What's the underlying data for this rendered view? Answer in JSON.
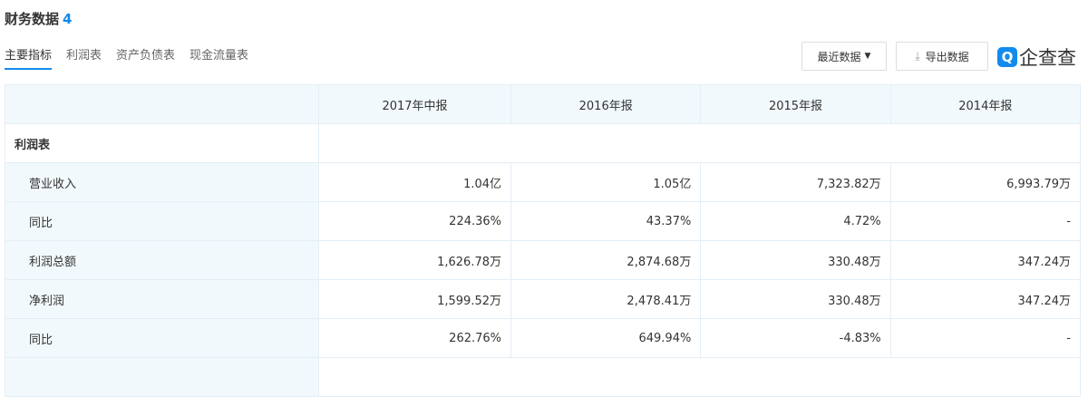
{
  "header": {
    "title": "财务数据",
    "count": "4"
  },
  "tabs": [
    "主要指标",
    "利润表",
    "资产负债表",
    "现金流量表"
  ],
  "toolbar": {
    "recent": "最近数据",
    "export": "导出数据",
    "logo_text": "企查查"
  },
  "table": {
    "columns": [
      "2017年中报",
      "2016年报",
      "2015年报",
      "2014年报"
    ],
    "section": "利润表",
    "rows": [
      {
        "label": "营业收入",
        "values": [
          "1.04亿",
          "1.05亿",
          "7,323.82万",
          "6,993.79万"
        ]
      },
      {
        "label": "同比",
        "values": [
          "224.36%",
          "43.37%",
          "4.72%",
          "-"
        ]
      },
      {
        "label": "利润总额",
        "values": [
          "1,626.78万",
          "2,874.68万",
          "330.48万",
          "347.24万"
        ]
      },
      {
        "label": "净利润",
        "values": [
          "1,599.52万",
          "2,478.41万",
          "330.48万",
          "347.24万"
        ]
      },
      {
        "label": "同比",
        "values": [
          "262.76%",
          "649.94%",
          "-4.83%",
          "-"
        ]
      }
    ]
  }
}
